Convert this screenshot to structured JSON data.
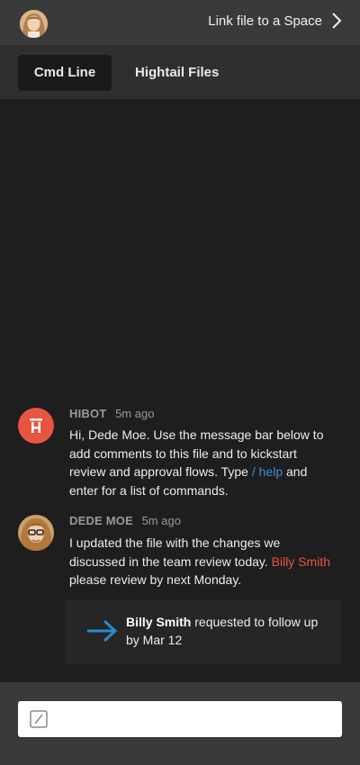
{
  "header": {
    "link_label": "Link file to a Space"
  },
  "tabs": [
    {
      "label": "Cmd Line",
      "active": true
    },
    {
      "label": "Hightail Files",
      "active": false
    }
  ],
  "messages": [
    {
      "sender": "HIBOT",
      "time": "5m ago",
      "text_part1": "Hi, Dede Moe. Use the message bar below to add comments to this file and to kickstart review and approval flows. Type ",
      "command": "/ help",
      "text_part2": " and enter for a list of commands."
    },
    {
      "sender": "DEDE MOE",
      "time": "5m ago",
      "text_part1": "I updated the file with the changes we discussed in the team review today. ",
      "mention": "Billy Smith",
      "text_part2": " please review by next Monday."
    }
  ],
  "followup_card": {
    "name": "Billy Smith",
    "text": " requested to follow up by Mar 12"
  },
  "composer": {
    "placeholder": ""
  },
  "colors": {
    "hibot_red": "#e8553f",
    "link_blue": "#3b8fd6",
    "arrow_blue": "#2a8bd0"
  }
}
